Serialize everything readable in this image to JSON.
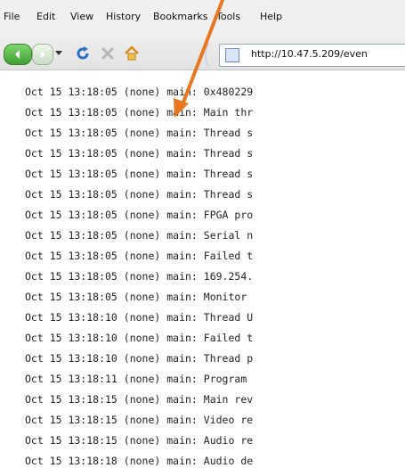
{
  "menubar": {
    "items": [
      "File",
      "Edit",
      "View",
      "History",
      "Bookmarks",
      "Tools",
      "Help"
    ]
  },
  "navbar": {
    "url": "http://10.47.5.209/even",
    "icons": [
      "back-arrow-icon",
      "forward-arrow-icon",
      "dropdown-icon",
      "reload-icon",
      "stop-icon",
      "home-icon",
      "page-icon"
    ]
  },
  "log": {
    "lines": [
      "Oct 15 13:18:05 (none) main: 0x480229",
      "Oct 15 13:18:05 (none) main: Main thr",
      "Oct 15 13:18:05 (none) main: Thread s",
      "Oct 15 13:18:05 (none) main: Thread s",
      "Oct 15 13:18:05 (none) main: Thread s",
      "Oct 15 13:18:05 (none) main: Thread s",
      "Oct 15 13:18:05 (none) main: FPGA pro",
      "Oct 15 13:18:05 (none) main: Serial n",
      "Oct 15 13:18:05 (none) main: Failed t",
      "Oct 15 13:18:05 (none) main: 169.254.",
      "Oct 15 13:18:05 (none) main: Monitor ",
      "Oct 15 13:18:10 (none) main: Thread U",
      "Oct 15 13:18:10 (none) main: Failed t",
      "Oct 15 13:18:10 (none) main: Thread p",
      "Oct 15 13:18:11 (none) main: Program ",
      "Oct 15 13:18:15 (none) main: Main rev",
      "Oct 15 13:18:15 (none) main: Video re",
      "Oct 15 13:18:15 (none) main: Audio re",
      "Oct 15 13:18:18 (none) main: Audio de"
    ]
  },
  "colors": {
    "annotation_arrow": "#e87722"
  }
}
